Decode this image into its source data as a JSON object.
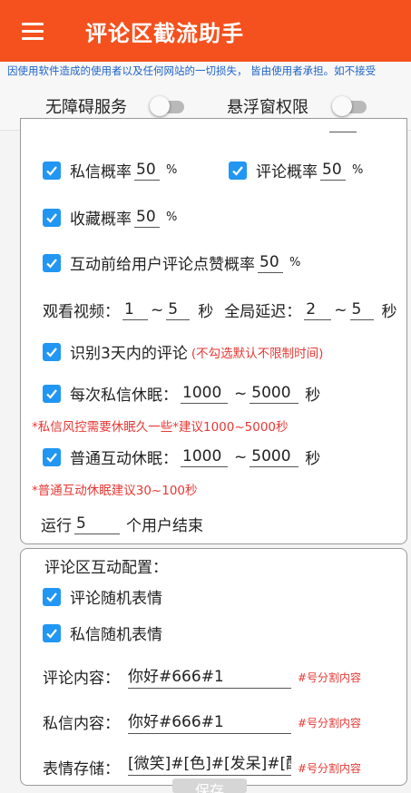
{
  "app": {
    "title": "评论区截流助手"
  },
  "disclaimer": "因使用软件造成的使用者以及任何网站的一切损失， 皆由使用者承担。如不接受",
  "permissions": {
    "accessibility_label": "无障碍服务",
    "overlay_label": "悬浮窗权限",
    "accessibility_on": false,
    "overlay_on": false
  },
  "settings": {
    "private_msg_label": "私信概率",
    "private_msg_value": "50",
    "comment_label": "评论概率",
    "comment_value": "50",
    "favorite_label": "收藏概率",
    "favorite_value": "50",
    "like_label": "互动前给用户评论点赞概率",
    "like_value": "50",
    "percent": "%",
    "watch_label": "观看视频：",
    "watch_min": "1",
    "watch_max": "5",
    "sec": "秒",
    "delay_label": "全局延迟：",
    "delay_min": "2",
    "delay_max": "5",
    "tilde": "~",
    "recent_label": "识别3天内的评论",
    "recent_note": "(不勾选默认不限制时间)",
    "pm_sleep_label": "每次私信休眠：",
    "pm_sleep_min": "1000",
    "pm_sleep_max": "5000",
    "pm_note": "*私信风控需要休眠久一些*建议1000~5000秒",
    "normal_sleep_label": "普通互动休眠：",
    "normal_sleep_min": "1000",
    "normal_sleep_max": "5000",
    "normal_note": "*普通互动休眠建议30~100秒",
    "run_label": "运行",
    "run_value": "5",
    "run_suffix": "个用户结束"
  },
  "interaction": {
    "header": "评论区互动配置：",
    "comment_emoji_label": "评论随机表情",
    "pm_emoji_label": "私信随机表情",
    "comment_content_label": "评论内容：",
    "comment_content_value": "你好#666#1",
    "pm_content_label": "私信内容：",
    "pm_content_value": "你好#666#1",
    "emoji_store_label": "表情存储：",
    "emoji_store_value": "[微笑]#[色]#[发呆]#[酷",
    "hint": "#号分割内容",
    "save_label": "保存"
  },
  "colors": {
    "appbar": "#f4511e",
    "checkbox": "#2196f3",
    "link_blue": "#1e63c8",
    "warn_red": "#e53935"
  }
}
